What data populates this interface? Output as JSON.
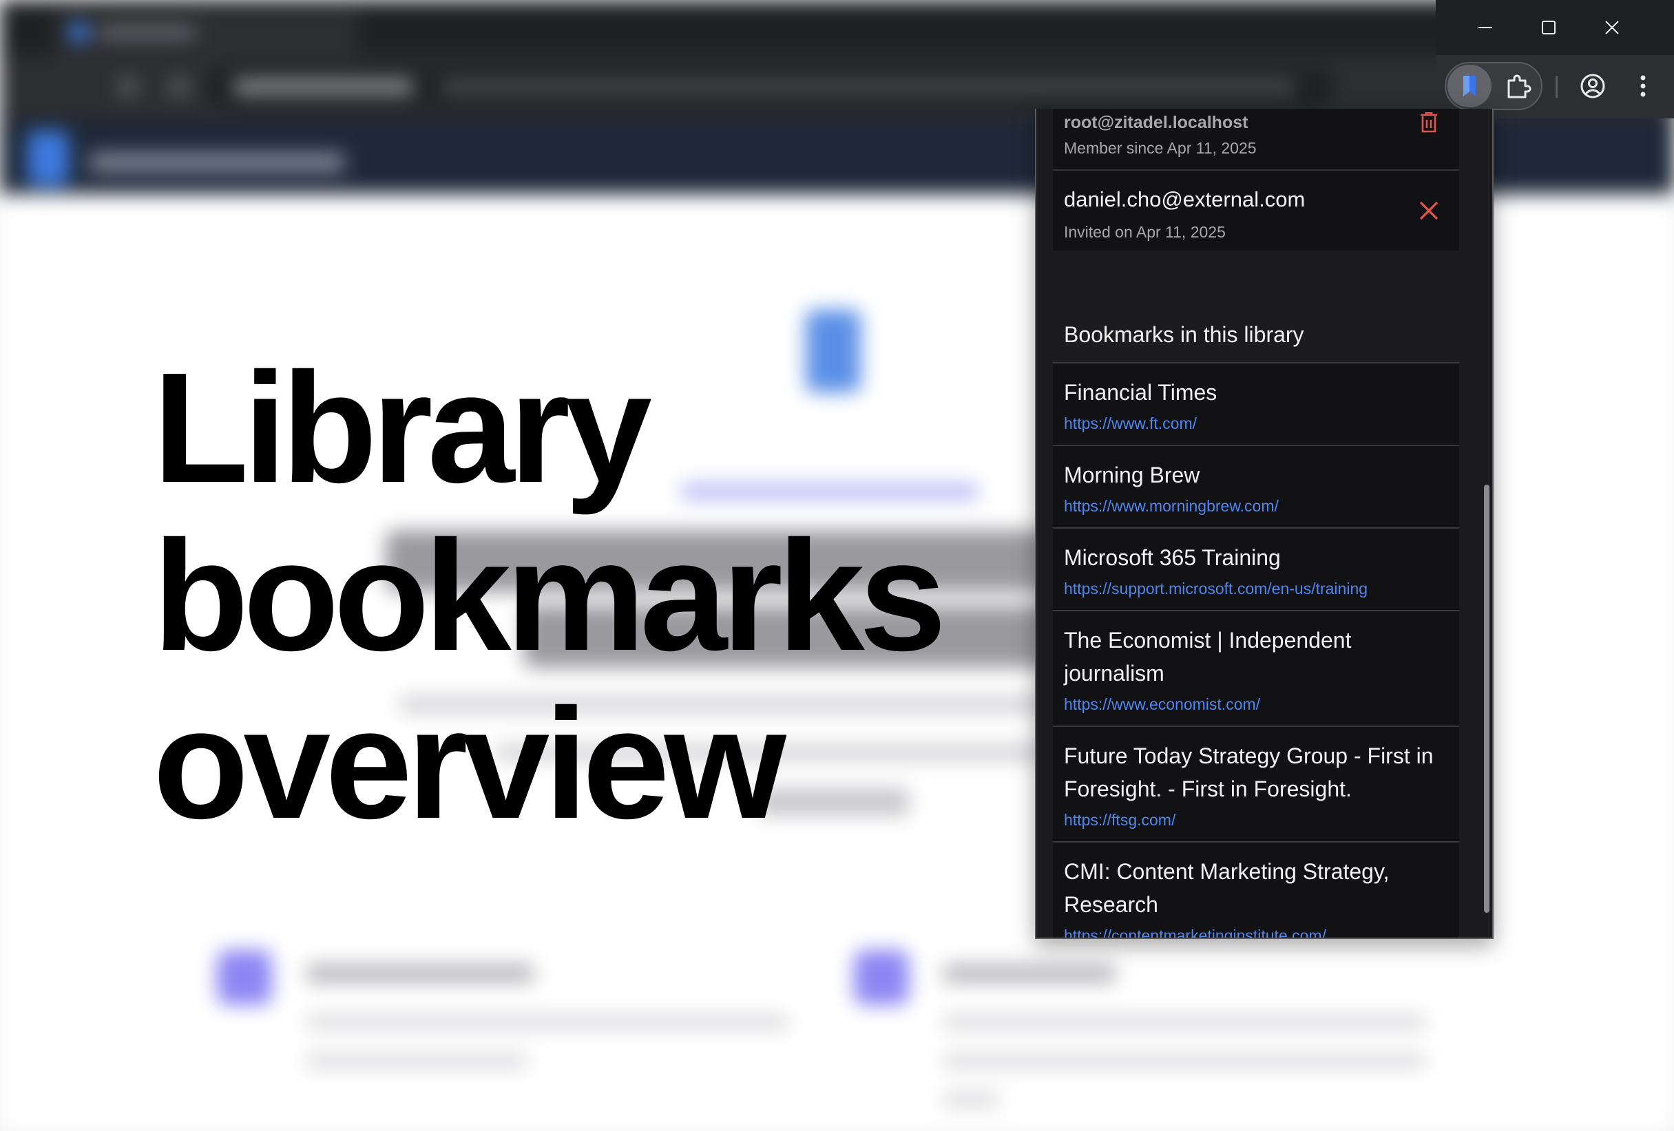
{
  "overlay": {
    "title_lines": [
      "Library",
      "bookmarks",
      "overview"
    ]
  },
  "popup": {
    "members": [
      {
        "email": "root@zitadel.localhost",
        "meta": "Member since Apr 11, 2025",
        "action_icon": "trash-icon"
      },
      {
        "email": "daniel.cho@external.com",
        "meta": "Invited on Apr 11, 2025",
        "action_icon": "close-icon"
      }
    ],
    "bookmarks_heading": "Bookmarks in this library",
    "bookmarks": [
      {
        "title": "Financial Times",
        "url": "https://www.ft.com/"
      },
      {
        "title": "Morning Brew",
        "url": "https://www.morningbrew.com/"
      },
      {
        "title": "Microsoft 365 Training",
        "url": "https://support.microsoft.com/en-us/training"
      },
      {
        "title": "The Economist | Independent journalism",
        "url": "https://www.economist.com/"
      },
      {
        "title": "Future Today Strategy Group - First in Foresight. - First in Foresight.",
        "url": "https://ftsg.com/"
      },
      {
        "title": "CMI: Content Marketing Strategy, Research",
        "url": "https://contentmarketinginstitute.com/"
      }
    ]
  },
  "colors": {
    "danger": "#e5534b",
    "link": "#4d87f0",
    "popup_bg": "#1c1c1e",
    "item_bg": "#121214"
  },
  "toolbar_icons": [
    "bookmark-extension-icon",
    "puzzle-icon",
    "account-icon",
    "more-vert-icon"
  ],
  "window_controls": [
    "minimize-icon",
    "maximize-icon",
    "close-window-icon"
  ]
}
